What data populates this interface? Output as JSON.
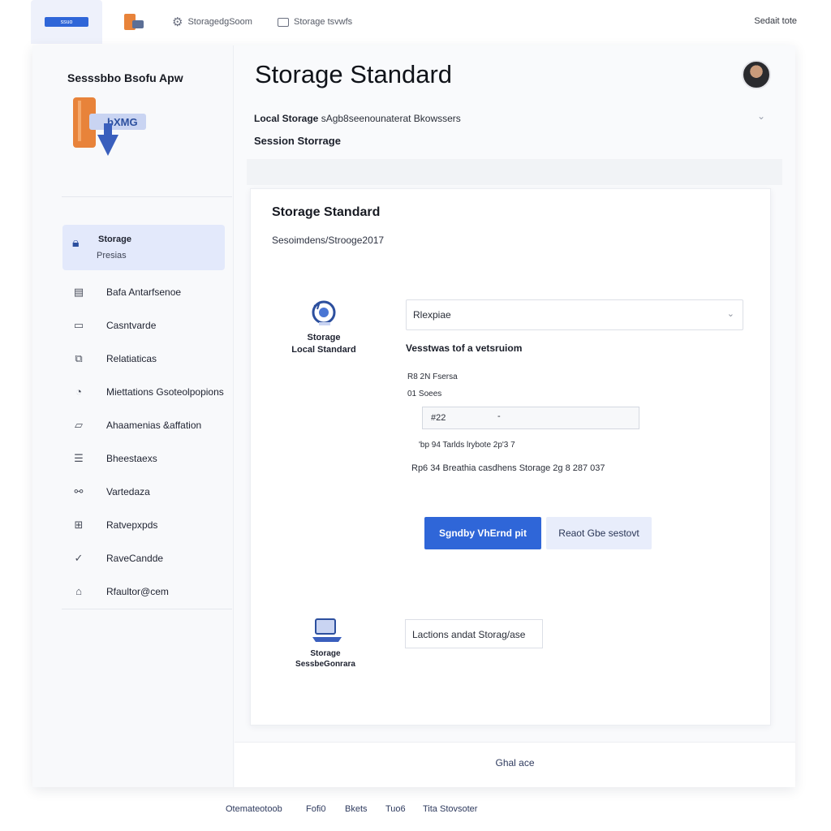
{
  "topbar": {
    "tabs": [
      {
        "label": "",
        "chip": "ssuo"
      },
      {
        "label": ""
      },
      {
        "label": "StoragedgSoom"
      },
      {
        "label": "Storage tsvwfs"
      }
    ],
    "right_label": "Sedait tote"
  },
  "sidebar": {
    "title": "Sesssbbo Bsofu Apw",
    "logo_text": "bXMG",
    "active_item": {
      "label": "Storage",
      "sublabel": "Presias"
    },
    "items": [
      {
        "label": "Bafa Antarfsenoe",
        "icon": "browser-window-icon"
      },
      {
        "label": "Casntvarde",
        "icon": "tray-icon"
      },
      {
        "label": "Relatiaticas",
        "icon": "expand-square-icon"
      },
      {
        "label": "Miettations Gsoteolpopions",
        "icon": "gauge-icon"
      },
      {
        "label": "Ahaamenias &affation",
        "icon": "network-icon"
      },
      {
        "label": "Bheestaexs",
        "icon": "document-list-icon"
      },
      {
        "label": "Vartedaza",
        "icon": "share-nodes-icon"
      },
      {
        "label": "Ratvepxpds",
        "icon": "grid-box-icon"
      },
      {
        "label": "RaveCandde",
        "icon": "check-circle-icon"
      },
      {
        "label": "Rfaultor@cem",
        "icon": "graduation-cap-icon"
      }
    ]
  },
  "header": {
    "title": "Storage Standard",
    "row1_bold": "Local Storage",
    "row1_rest": " sAgb8seenounaterat Bkowssers",
    "row2": "Session Storrage"
  },
  "panel": {
    "title": "Storage Standard",
    "subtitle": "Sesoimdens/Strooge2017",
    "storage_label_1_line1": "Storage",
    "storage_label_1_line2": "Local Standard",
    "select_value": "Rlexpiae",
    "section_heading": "Vesstwas tof a vetsruiom",
    "small_1": "R8 2N Fsersa",
    "small_2": "01 Soees",
    "input_value": "#22",
    "input_dash": "-",
    "line_1": "'bp 94 Tarlds lrybote 2p'3 7",
    "line_2": "Rp6 34 Breathia casdhens Storage 2g 8 287 037",
    "primary_button": "Sgndby VhErnd pit",
    "secondary_button": "Reaot Gbe sestovt",
    "storage_label_2_line1": "Storage",
    "storage_label_2_line2": "SessbeGonrara",
    "location_value": "Lactions andat Storag/ase"
  },
  "bottom_strip": {
    "label": "Ghal ace"
  },
  "footer": {
    "links": [
      "Otemateotoob",
      "Fofi0",
      "Bkets",
      "Tuo6",
      "Tita Stovsoter"
    ]
  },
  "colors": {
    "accent": "#2f66d8",
    "active_nav_bg": "#e3e9fb",
    "logo_orange": "#e8833a",
    "logo_blue": "#3a5fbd"
  }
}
